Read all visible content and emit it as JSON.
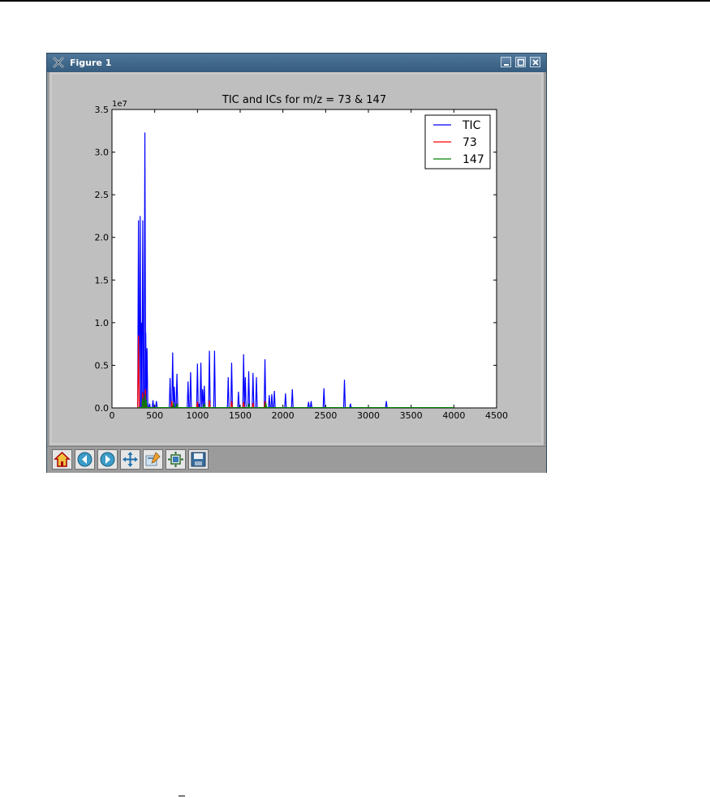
{
  "window": {
    "title": "Figure 1"
  },
  "toolbar": {
    "buttons": [
      "home-icon",
      "back-icon",
      "forward-icon",
      "pan-icon",
      "zoom-to-rect-icon",
      "configure-subplots-icon",
      "save-icon"
    ]
  },
  "chart_data": {
    "type": "line",
    "title": "TIC and ICs for m/z = 73 & 147",
    "xlabel": "",
    "ylabel": "",
    "xlim": [
      0,
      4500
    ],
    "ylim": [
      0,
      35000000
    ],
    "y_multiplier_label": "1e7",
    "xticks": [
      "0",
      "500",
      "1000",
      "1500",
      "2000",
      "2500",
      "3000",
      "3500",
      "4000",
      "4500"
    ],
    "yticks": [
      "0.0",
      "0.5",
      "1.0",
      "1.5",
      "2.0",
      "2.5",
      "3.0",
      "3.5"
    ],
    "legend_position": "top-right",
    "series": [
      {
        "name": "TIC",
        "color": "#0000ff",
        "peaks": [
          [
            310,
            22000000
          ],
          [
            330,
            22500000
          ],
          [
            345,
            10000000
          ],
          [
            360,
            22000000
          ],
          [
            385,
            32300000
          ],
          [
            395,
            8800000
          ],
          [
            410,
            7000000
          ],
          [
            440,
            500000
          ],
          [
            480,
            900000
          ],
          [
            520,
            800000
          ],
          [
            680,
            3500000
          ],
          [
            710,
            6500000
          ],
          [
            730,
            2500000
          ],
          [
            760,
            4000000
          ],
          [
            890,
            3100000
          ],
          [
            920,
            4200000
          ],
          [
            1000,
            5200000
          ],
          [
            1020,
            500000
          ],
          [
            1040,
            5300000
          ],
          [
            1060,
            2200000
          ],
          [
            1080,
            2600000
          ],
          [
            1140,
            6700000
          ],
          [
            1200,
            6700000
          ],
          [
            1360,
            3600000
          ],
          [
            1400,
            5300000
          ],
          [
            1480,
            1900000
          ],
          [
            1540,
            6300000
          ],
          [
            1560,
            3600000
          ],
          [
            1600,
            4300000
          ],
          [
            1650,
            4100000
          ],
          [
            1690,
            3600000
          ],
          [
            1790,
            5700000
          ],
          [
            1840,
            1500000
          ],
          [
            1870,
            1600000
          ],
          [
            1900,
            2000000
          ],
          [
            2030,
            1700000
          ],
          [
            2110,
            2200000
          ],
          [
            2300,
            700000
          ],
          [
            2330,
            800000
          ],
          [
            2480,
            2300000
          ],
          [
            2720,
            3300000
          ],
          [
            2790,
            500000
          ],
          [
            3210,
            800000
          ]
        ]
      },
      {
        "name": "73",
        "color": "#ff0000",
        "peaks": [
          [
            310,
            8500000
          ],
          [
            360,
            1800000
          ],
          [
            390,
            2200000
          ],
          [
            700,
            800000
          ],
          [
            1000,
            700000
          ],
          [
            1140,
            900000
          ],
          [
            1400,
            800000
          ],
          [
            1540,
            700000
          ],
          [
            1650,
            600000
          ],
          [
            1790,
            800000
          ]
        ]
      },
      {
        "name": "147",
        "color": "#008000",
        "peaks": [
          [
            360,
            1200000
          ],
          [
            385,
            1600000
          ],
          [
            400,
            900000
          ],
          [
            720,
            600000
          ],
          [
            760,
            500000
          ],
          [
            1080,
            500000
          ],
          [
            1600,
            500000
          ],
          [
            1800,
            600000
          ]
        ]
      }
    ]
  }
}
